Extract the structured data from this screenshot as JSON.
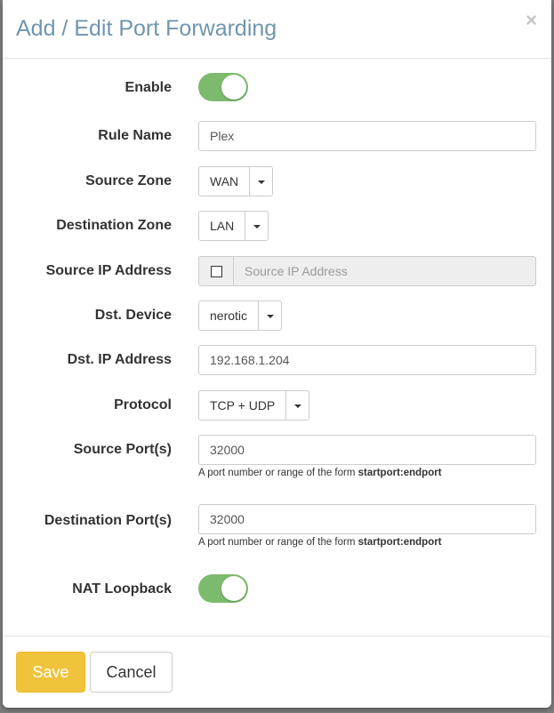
{
  "modal": {
    "title": "Add / Edit Port Forwarding",
    "close_symbol": "×"
  },
  "colors": {
    "toggle_on": "#7cbb6d",
    "save_button": "#f0c33c",
    "title": "#6f96ad"
  },
  "form": {
    "enable": {
      "label": "Enable",
      "on": true
    },
    "rule_name": {
      "label": "Rule Name",
      "value": "Plex"
    },
    "source_zone": {
      "label": "Source Zone",
      "value": "WAN"
    },
    "destination_zone": {
      "label": "Destination Zone",
      "value": "LAN"
    },
    "source_ip": {
      "label": "Source IP Address",
      "placeholder": "Source IP Address",
      "checked": false
    },
    "dst_device": {
      "label": "Dst. Device",
      "value": "nerotic"
    },
    "dst_ip": {
      "label": "Dst. IP Address",
      "value": "192.168.1.204"
    },
    "protocol": {
      "label": "Protocol",
      "value": "TCP + UDP"
    },
    "source_ports": {
      "label": "Source Port(s)",
      "value": "32000",
      "help_prefix": "A port number or range of the form ",
      "help_bold": "startport:endport"
    },
    "destination_ports": {
      "label": "Destination Port(s)",
      "value": "32000",
      "help_prefix": "A port number or range of the form ",
      "help_bold": "startport:endport"
    },
    "nat_loopback": {
      "label": "NAT Loopback",
      "on": true
    }
  },
  "footer": {
    "save_label": "Save",
    "cancel_label": "Cancel"
  }
}
